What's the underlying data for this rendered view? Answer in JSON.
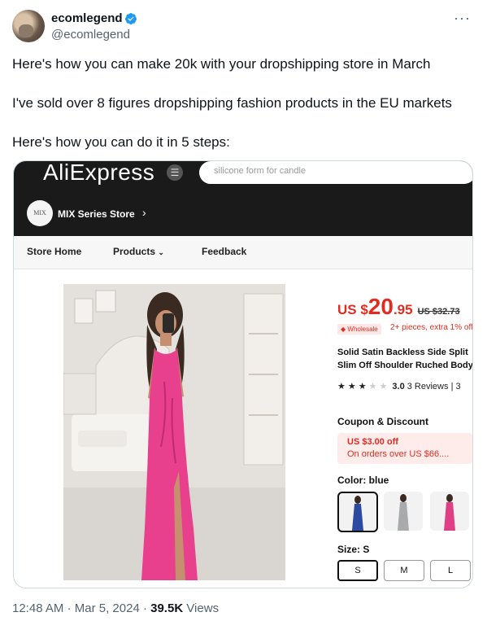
{
  "author": {
    "display_name": "ecomlegend",
    "handle": "@ecomlegend",
    "verified": true,
    "more_icon": "more-dots-icon"
  },
  "tweet": {
    "lines": [
      "Here's how you can make 20k with your dropshipping store in March",
      "I've sold over 8 figures dropshipping fashion products in the EU markets",
      "Here's how you can do it in 5 steps:"
    ]
  },
  "screenshot": {
    "logo": "AliExpress",
    "search_placeholder": "silicone form for candle",
    "store_logo_text": "MIX",
    "store_name": "MIX Series Store",
    "nav": [
      "Store Home",
      "Products",
      "Feedback"
    ],
    "price": {
      "currency": "US $",
      "int": "20",
      "dec": ".95",
      "old": "US $32.73"
    },
    "wholesale_tag": "Wholesale",
    "wholesale_text": "2+ pieces, extra 1% off",
    "title_line1": "Solid Satin Backless Side Split",
    "title_line2": "Slim Off Shoulder Ruched Bodycon",
    "rating": {
      "stars": 3,
      "score": "3.0",
      "reviews": "3 Reviews",
      "sep": "|",
      "extra": "3"
    },
    "coupon_label": "Coupon & Discount",
    "coupon_title": "US $3.00 off",
    "coupon_sub": "On orders over US $66....",
    "color_label": "Color: blue",
    "colors": [
      {
        "name": "blue",
        "hex": "#2b4aa0"
      },
      {
        "name": "silver",
        "hex": "#a9aaad"
      },
      {
        "name": "pink",
        "hex": "#e03f85"
      }
    ],
    "size_label": "Size: S",
    "sizes": [
      "S",
      "M",
      "L"
    ]
  },
  "meta": {
    "time": "12:48 AM",
    "sep": "·",
    "date": "Mar 5, 2024",
    "views_count": "39.5K",
    "views_label": "Views"
  },
  "colors": {
    "verified": "#1d9bf0",
    "price": "#e02d22",
    "dress": "#e8408c"
  }
}
